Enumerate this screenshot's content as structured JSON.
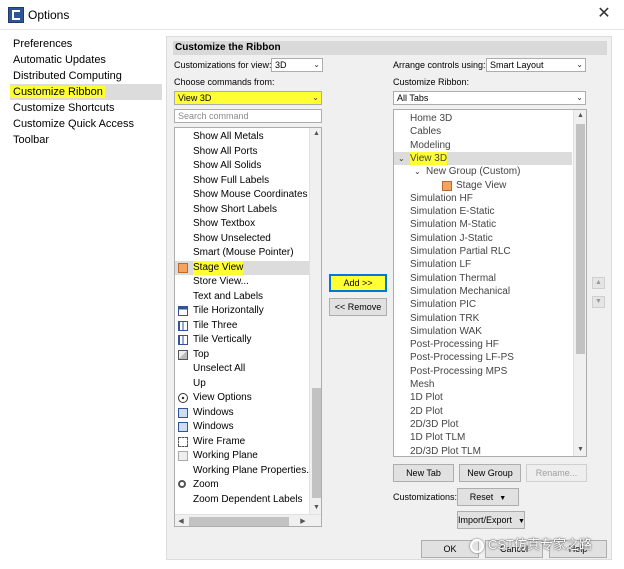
{
  "window": {
    "title": "Options",
    "close_glyph": "✕"
  },
  "nav": {
    "items": [
      {
        "label": "Preferences"
      },
      {
        "label": "Automatic Updates"
      },
      {
        "label": "Distributed Computing"
      },
      {
        "label": "Customize Ribbon"
      },
      {
        "label": "Customize Shortcuts"
      },
      {
        "label": "Customize Quick Access Toolbar"
      }
    ],
    "active_index": 3
  },
  "panel": {
    "header": "Customize the Ribbon",
    "customizations_for_view_label": "Customizations for view:",
    "customizations_for_view_value": "3D",
    "arrange_controls_label": "Arrange controls using:",
    "arrange_controls_value": "Smart Layout",
    "choose_commands_label": "Choose commands from:",
    "choose_commands_value": "View 3D",
    "customize_ribbon_label": "Customize Ribbon:",
    "customize_ribbon_value": "All Tabs",
    "search_placeholder": "Search command"
  },
  "commands": [
    {
      "label": "Show All Metals",
      "icon": "none"
    },
    {
      "label": "Show All Ports",
      "icon": "none"
    },
    {
      "label": "Show All Solids",
      "icon": "none"
    },
    {
      "label": "Show Full Labels",
      "icon": "none"
    },
    {
      "label": "Show Mouse Coordinates",
      "icon": "none"
    },
    {
      "label": "Show Short Labels",
      "icon": "none"
    },
    {
      "label": "Show Textbox",
      "icon": "none"
    },
    {
      "label": "Show Unselected",
      "icon": "none"
    },
    {
      "label": "Smart (Mouse Pointer)",
      "icon": "none"
    },
    {
      "label": "Stage View",
      "icon": "stage-view-icon",
      "selected": true
    },
    {
      "label": "Store View...",
      "icon": "none"
    },
    {
      "label": "Text and Labels",
      "icon": "none"
    },
    {
      "label": "Tile Horizontally",
      "icon": "tile-horizontal-icon"
    },
    {
      "label": "Tile Three",
      "icon": "tile-three-icon"
    },
    {
      "label": "Tile Vertically",
      "icon": "tile-vertical-icon"
    },
    {
      "label": "Top",
      "icon": "top-view-icon"
    },
    {
      "label": "Unselect All",
      "icon": "none"
    },
    {
      "label": "Up",
      "icon": "none"
    },
    {
      "label": "View Options",
      "icon": "view-options-icon"
    },
    {
      "label": "Windows",
      "icon": "windows-icon"
    },
    {
      "label": "Windows",
      "icon": "windows-icon"
    },
    {
      "label": "Wire Frame",
      "icon": "wire-frame-icon"
    },
    {
      "label": "Working Plane",
      "icon": "working-plane-icon"
    },
    {
      "label": "Working Plane Properties...",
      "icon": "none"
    },
    {
      "label": "Zoom",
      "icon": "zoom-icon"
    },
    {
      "label": "Zoom Dependent Labels",
      "icon": "none"
    }
  ],
  "buttons": {
    "add": "Add >>",
    "remove": "<< Remove",
    "new_tab": "New Tab",
    "new_group": "New Group",
    "rename": "Rename...",
    "customizations_label": "Customizations:",
    "reset": "Reset",
    "import_export": "Import/Export",
    "ok": "OK",
    "cancel": "Cancel",
    "help": "Help"
  },
  "ribbon_tree": [
    {
      "label": "Home 3D",
      "level": 0
    },
    {
      "label": "Cables",
      "level": 0
    },
    {
      "label": "Modeling",
      "level": 0
    },
    {
      "label": "View 3D",
      "level": 0,
      "expanded": true,
      "selected": true
    },
    {
      "label": "New Group (Custom)",
      "level": 1,
      "expanded": true
    },
    {
      "label": "Stage View",
      "level": 2,
      "icon": "stage-view-icon"
    },
    {
      "label": "Simulation HF",
      "level": 0
    },
    {
      "label": "Simulation E-Static",
      "level": 0
    },
    {
      "label": "Simulation M-Static",
      "level": 0
    },
    {
      "label": "Simulation J-Static",
      "level": 0
    },
    {
      "label": "Simulation Partial RLC",
      "level": 0
    },
    {
      "label": "Simulation LF",
      "level": 0
    },
    {
      "label": "Simulation Thermal",
      "level": 0
    },
    {
      "label": "Simulation Mechanical",
      "level": 0
    },
    {
      "label": "Simulation PIC",
      "level": 0
    },
    {
      "label": "Simulation TRK",
      "level": 0
    },
    {
      "label": "Simulation WAK",
      "level": 0
    },
    {
      "label": "Post-Processing HF",
      "level": 0
    },
    {
      "label": "Post-Processing LF-PS",
      "level": 0
    },
    {
      "label": "Post-Processing MPS",
      "level": 0
    },
    {
      "label": "Mesh",
      "level": 0
    },
    {
      "label": "1D Plot",
      "level": 0
    },
    {
      "label": "2D Plot",
      "level": 0
    },
    {
      "label": "2D/3D Plot",
      "level": 0
    },
    {
      "label": "1D Plot TLM",
      "level": 0
    },
    {
      "label": "2D/3D Plot TLM",
      "level": 0
    }
  ],
  "watermark": "CST仿真专家之路",
  "colors": {
    "highlight": "#ffff33",
    "selection_row": "#dcdcdc",
    "panel_bg": "#f0f0f0"
  }
}
